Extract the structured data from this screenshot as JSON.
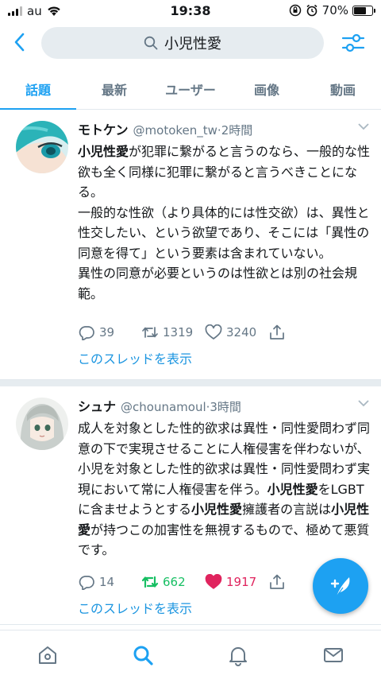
{
  "status_bar": {
    "carrier": "au",
    "time": "19:38",
    "battery_percent": "70%",
    "battery_level": 0.7
  },
  "search": {
    "query": "小児性愛"
  },
  "tabs": [
    {
      "label": "話題",
      "active": true
    },
    {
      "label": "最新",
      "active": false
    },
    {
      "label": "ユーザー",
      "active": false
    },
    {
      "label": "画像",
      "active": false
    },
    {
      "label": "動画",
      "active": false
    }
  ],
  "tweets": [
    {
      "name": "モトケン",
      "handle": "@motoken_tw",
      "time": "·2時間",
      "text_html": "<b>小児性愛</b>が犯罪に繋がると言うのなら、一般的な性欲も全く同様に犯罪に繋がると言うべきことになる。<br>一般的な性欲（より具体的には性交欲）は、異性と性交したい、という欲望であり、そこには「異性の同意を得て」という要素は含まれていない。<br>異性の同意が必要というのは性欲とは別の社会規範。",
      "replies": "39",
      "retweets": "1319",
      "likes": "3240",
      "thread_link": "このスレッドを表示"
    },
    {
      "name": "シュナ",
      "handle": "@chounamoul",
      "time": "·3時間",
      "text_html": "成人を対象とした性的欲求は異性・同性愛問わず同意の下で実現させることに人権侵害を伴わないが、小児を対象とした性的欲求は異性・同性愛問わず実現において常に人権侵害を伴う。<b>小児性愛</b>をLGBTに含ませようとする<b>小児性愛</b>擁護者の言説は<b>小児性愛</b>が持つこの加害性を無視するもので、極めて悪質です。",
      "replies": "14",
      "retweets": "662",
      "likes": "1917",
      "thread_link": "このスレッドを表示"
    }
  ],
  "colors": {
    "accent": "#1da1f2",
    "retweet_active": "#17bf63",
    "like_active": "#e0245e",
    "secondary_text": "#657786"
  },
  "icons": [
    "back-arrow-icon",
    "search-icon",
    "filter-sliders-icon",
    "chevron-down-icon",
    "reply-icon",
    "retweet-icon",
    "heart-icon",
    "share-icon",
    "compose-feather-icon",
    "home-icon",
    "explore-search-icon",
    "notifications-bell-icon",
    "messages-envelope-icon"
  ]
}
